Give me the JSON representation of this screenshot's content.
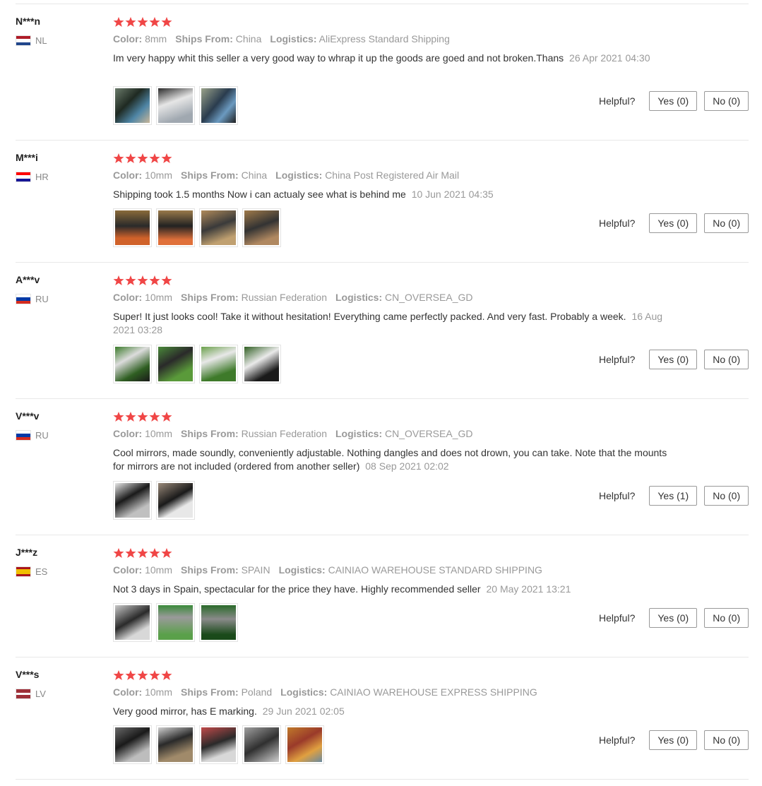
{
  "labels": {
    "color": "Color:",
    "ships_from": "Ships From:",
    "logistics": "Logistics:",
    "helpful": "Helpful?"
  },
  "accent_colors": {
    "star": "#f04646",
    "divider": "#e8e8e8",
    "muted_text": "#999999"
  },
  "reviews": [
    {
      "user": "N***n",
      "country": "NL",
      "flag_icon": "flag-netherlands-icon",
      "rating": 5,
      "color": "8mm",
      "ships_from": "China",
      "logistics": "AliExpress Standard Shipping",
      "text": "Im very happy whit this seller a very good way to whrap it up the goods are goed and not broken.Thans",
      "date": "26 Apr 2021 04:30",
      "photos": 3,
      "yes": "Yes (0)",
      "no": "No (0)"
    },
    {
      "user": "M***i",
      "country": "HR",
      "flag_icon": "flag-croatia-icon",
      "rating": 5,
      "color": "10mm",
      "ships_from": "China",
      "logistics": "China Post Registered Air Mail",
      "text": "Shipping took 1.5 months Now i can actualy see what is behind me",
      "date": "10 Jun 2021 04:35",
      "photos": 4,
      "yes": "Yes (0)",
      "no": "No (0)"
    },
    {
      "user": "A***v",
      "country": "RU",
      "flag_icon": "flag-russia-icon",
      "rating": 5,
      "color": "10mm",
      "ships_from": "Russian Federation",
      "logistics": "CN_OVERSEA_GD",
      "text": "Super! It just looks cool! Take it without hesitation! Everything came perfectly packed. And very fast. Probably a week.",
      "date": "16 Aug 2021 03:28",
      "photos": 4,
      "yes": "Yes (0)",
      "no": "No (0)"
    },
    {
      "user": "V***v",
      "country": "RU",
      "flag_icon": "flag-russia-icon",
      "rating": 5,
      "color": "10mm",
      "ships_from": "Russian Federation",
      "logistics": "CN_OVERSEA_GD",
      "text": "Cool mirrors, made soundly, conveniently adjustable. Nothing dangles and does not drown, you can take. Note that the mounts for mirrors are not included (ordered from another seller)",
      "date": "08 Sep 2021 02:02",
      "photos": 2,
      "yes": "Yes (1)",
      "no": "No (0)"
    },
    {
      "user": "J***z",
      "country": "ES",
      "flag_icon": "flag-spain-icon",
      "rating": 5,
      "color": "10mm",
      "ships_from": "SPAIN",
      "logistics": "CAINIAO WAREHOUSE STANDARD SHIPPING",
      "text": "Not 3 days in Spain, spectacular for the price they have. Highly recommended seller",
      "date": "20 May 2021 13:21",
      "photos": 3,
      "yes": "Yes (0)",
      "no": "No (0)"
    },
    {
      "user": "V***s",
      "country": "LV",
      "flag_icon": "flag-latvia-icon",
      "rating": 5,
      "color": "10mm",
      "ships_from": "Poland",
      "logistics": "CAINIAO WAREHOUSE EXPRESS SHIPPING",
      "text": "Very good mirror, has E marking.",
      "date": "29 Jun 2021 02:05",
      "photos": 5,
      "yes": "Yes (0)",
      "no": "No (0)"
    }
  ]
}
